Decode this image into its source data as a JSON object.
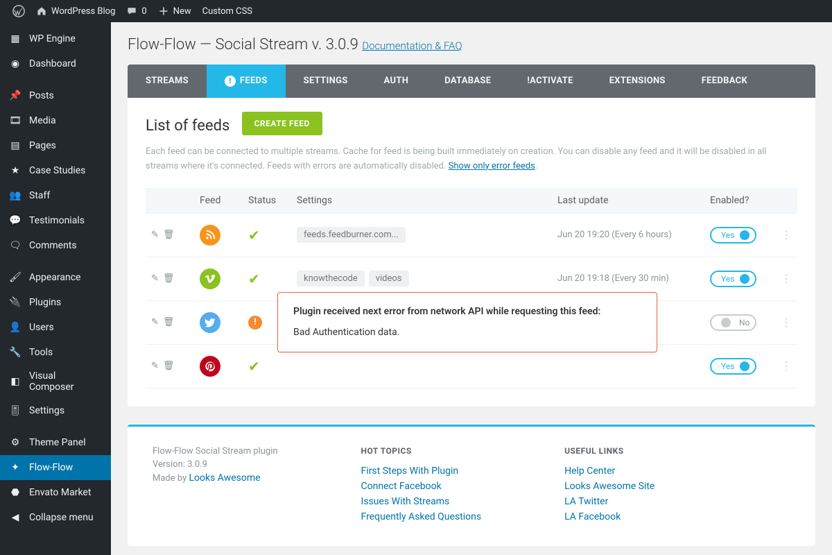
{
  "adminbar": {
    "site_name": "WordPress Blog",
    "comments_count": "0",
    "new_label": "New",
    "custom_css_label": "Custom CSS"
  },
  "sidebar": {
    "items": [
      {
        "label": "WP Engine",
        "icon": "wpengine-icon"
      },
      {
        "label": "Dashboard",
        "icon": "dashboard-icon"
      },
      {
        "label": "Posts",
        "icon": "pin-icon"
      },
      {
        "label": "Media",
        "icon": "media-icon"
      },
      {
        "label": "Pages",
        "icon": "pages-icon"
      },
      {
        "label": "Case Studies",
        "icon": "star-icon"
      },
      {
        "label": "Staff",
        "icon": "people-icon"
      },
      {
        "label": "Testimonials",
        "icon": "chat-icon"
      },
      {
        "label": "Comments",
        "icon": "comment-icon"
      },
      {
        "label": "Appearance",
        "icon": "brush-icon"
      },
      {
        "label": "Plugins",
        "icon": "plug-icon"
      },
      {
        "label": "Users",
        "icon": "user-icon"
      },
      {
        "label": "Tools",
        "icon": "wrench-icon"
      },
      {
        "label": "Visual Composer",
        "icon": "vc-icon"
      },
      {
        "label": "Settings",
        "icon": "sliders-icon"
      },
      {
        "label": "Theme Panel",
        "icon": "gear-icon"
      },
      {
        "label": "Flow-Flow",
        "icon": "flow-icon"
      },
      {
        "label": "Envato Market",
        "icon": "envato-icon"
      },
      {
        "label": "Collapse menu",
        "icon": "collapse-icon"
      }
    ],
    "active_index": 16
  },
  "page": {
    "title_prefix": "Flow-Flow — Social Stream v.",
    "version": "3.0.9",
    "doc_link": "Documentation & FAQ"
  },
  "tabs": [
    "STREAMS",
    "FEEDS",
    "SETTINGS",
    "AUTH",
    "DATABASE",
    "!ACTIVATE",
    "EXTENSIONS",
    "FEEDBACK"
  ],
  "tabs_active": 1,
  "feeds_panel": {
    "heading": "List of feeds",
    "create_label": "CREATE  FEED",
    "description": "Each feed can be connected to multiple streams. Cache for feed is being built immediately on creation. You can disable any feed and it will be disabled in all streams where it's connected. Feeds with errors are automatically disabled. ",
    "error_link": "Show only error feeds",
    "columns": {
      "c0": "",
      "c1": "Feed",
      "c2": "Status",
      "c3": "Settings",
      "c4": "Last update",
      "c5": "Enabled?",
      "c6": ""
    }
  },
  "feeds": [
    {
      "network": "rss",
      "status": "ok",
      "settings": [
        "feeds.feedburner.com..."
      ],
      "last_update": "Jun 20 19:20 (Every 6 hours)",
      "enabled": true,
      "enabled_label": "Yes"
    },
    {
      "network": "vimeo",
      "status": "ok",
      "settings": [
        "knowthecode",
        "videos"
      ],
      "last_update": "Jun 20 19:18 (Every 30 min)",
      "enabled": true,
      "enabled_label": "Yes"
    },
    {
      "network": "twitter",
      "status": "error",
      "settings": [],
      "last_update": "",
      "enabled": false,
      "enabled_label": "No"
    },
    {
      "network": "pinterest",
      "status": "ok",
      "settings": [],
      "last_update": "",
      "enabled": true,
      "enabled_label": "Yes"
    }
  ],
  "error_popover": {
    "heading": "Plugin received next error from network API while requesting this feed:",
    "body": "Bad Authentication data."
  },
  "footer": {
    "meta": {
      "name": "Flow-Flow Social Stream plugin",
      "version_label": "Version: 3.0.9",
      "made_by_prefix": "Made by ",
      "made_by_link": "Looks Awesome"
    },
    "hot_topics_label": "HOT TOPICS",
    "hot_topics": [
      "First Steps With Plugin",
      "Connect Facebook",
      "Issues With Streams",
      "Frequently Asked Questions"
    ],
    "useful_links_label": "USEFUL LINKS",
    "useful_links": [
      "Help Center",
      "Looks Awesome Site",
      "LA Twitter",
      "LA Facebook"
    ]
  }
}
